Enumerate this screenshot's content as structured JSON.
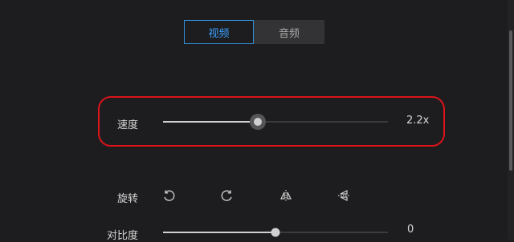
{
  "tabs": [
    {
      "label": "视频",
      "active": true
    },
    {
      "label": "音频",
      "active": false
    }
  ],
  "speed": {
    "label": "速度",
    "value_text": "2.2x",
    "fraction": 0.42
  },
  "rotate": {
    "label": "旋转",
    "icons": [
      "rotate-ccw-icon",
      "rotate-cw-icon",
      "flip-horizontal-icon",
      "flip-vertical-icon"
    ]
  },
  "contrast": {
    "label": "对比度",
    "value_text": "0",
    "fraction": 0.5
  },
  "colors": {
    "accent": "#2f8fd8",
    "highlight": "#d9141b",
    "background": "#1d1d1f"
  }
}
